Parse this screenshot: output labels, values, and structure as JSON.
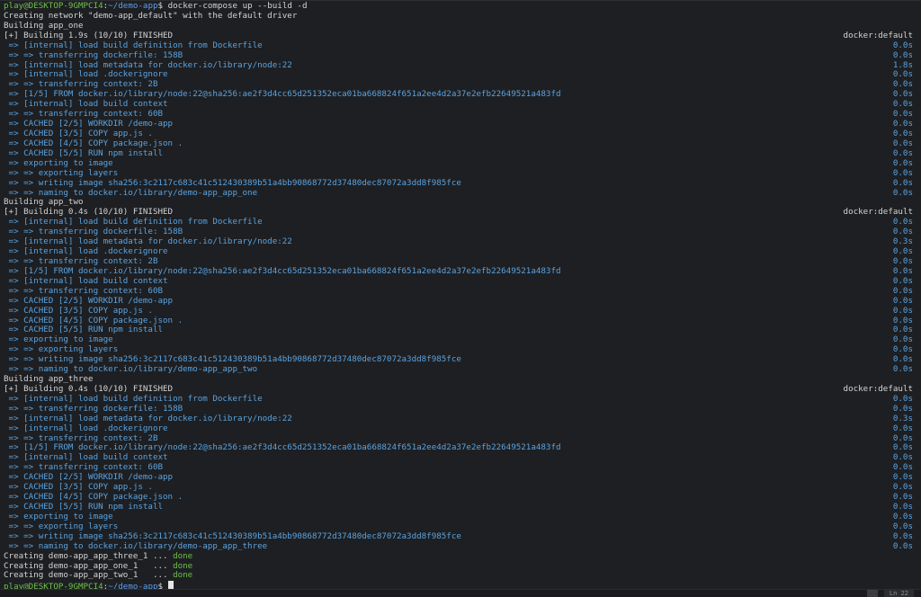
{
  "prompt": {
    "user_host": "play@DESKTOP-9GMPCI4",
    "path": "~/demo-app",
    "command": " docker-compose up --build -d"
  },
  "network_line": "Creating network \"demo-app_default\" with the default driver",
  "builds": [
    {
      "title": "Building app_one",
      "header": "[+] Building 1.9s (10/10) FINISHED",
      "driver": "docker:default",
      "steps": [
        {
          "text": " => [internal] load build definition from Dockerfile",
          "time": "0.0s"
        },
        {
          "text": " => => transferring dockerfile: 158B",
          "time": "0.0s"
        },
        {
          "text": " => [internal] load metadata for docker.io/library/node:22",
          "time": "1.8s"
        },
        {
          "text": " => [internal] load .dockerignore",
          "time": "0.0s"
        },
        {
          "text": " => => transferring context: 2B",
          "time": "0.0s"
        },
        {
          "text": " => [1/5] FROM docker.io/library/node:22@sha256:ae2f3d4cc65d251352eca01ba668824f651a2ee4d2a37e2efb22649521a483fd",
          "time": "0.0s"
        },
        {
          "text": " => [internal] load build context",
          "time": "0.0s"
        },
        {
          "text": " => => transferring context: 60B",
          "time": "0.0s"
        },
        {
          "text": " => CACHED [2/5] WORKDIR /demo-app",
          "time": "0.0s"
        },
        {
          "text": " => CACHED [3/5] COPY app.js .",
          "time": "0.0s"
        },
        {
          "text": " => CACHED [4/5] COPY package.json .",
          "time": "0.0s"
        },
        {
          "text": " => CACHED [5/5] RUN npm install",
          "time": "0.0s"
        },
        {
          "text": " => exporting to image",
          "time": "0.0s"
        },
        {
          "text": " => => exporting layers",
          "time": "0.0s"
        },
        {
          "text": " => => writing image sha256:3c2117c683c41c512430389b51a4bb90868772d37480dec87072a3dd8f985fce",
          "time": "0.0s"
        },
        {
          "text": " => => naming to docker.io/library/demo-app_app_one",
          "time": "0.0s"
        }
      ]
    },
    {
      "title": "Building app_two",
      "header": "[+] Building 0.4s (10/10) FINISHED",
      "driver": "docker:default",
      "steps": [
        {
          "text": " => [internal] load build definition from Dockerfile",
          "time": "0.0s"
        },
        {
          "text": " => => transferring dockerfile: 158B",
          "time": "0.0s"
        },
        {
          "text": " => [internal] load metadata for docker.io/library/node:22",
          "time": "0.3s"
        },
        {
          "text": " => [internal] load .dockerignore",
          "time": "0.0s"
        },
        {
          "text": " => => transferring context: 2B",
          "time": "0.0s"
        },
        {
          "text": " => [1/5] FROM docker.io/library/node:22@sha256:ae2f3d4cc65d251352eca01ba668824f651a2ee4d2a37e2efb22649521a483fd",
          "time": "0.0s"
        },
        {
          "text": " => [internal] load build context",
          "time": "0.0s"
        },
        {
          "text": " => => transferring context: 60B",
          "time": "0.0s"
        },
        {
          "text": " => CACHED [2/5] WORKDIR /demo-app",
          "time": "0.0s"
        },
        {
          "text": " => CACHED [3/5] COPY app.js .",
          "time": "0.0s"
        },
        {
          "text": " => CACHED [4/5] COPY package.json .",
          "time": "0.0s"
        },
        {
          "text": " => CACHED [5/5] RUN npm install",
          "time": "0.0s"
        },
        {
          "text": " => exporting to image",
          "time": "0.0s"
        },
        {
          "text": " => => exporting layers",
          "time": "0.0s"
        },
        {
          "text": " => => writing image sha256:3c2117c683c41c512430389b51a4bb90868772d37480dec87072a3dd8f985fce",
          "time": "0.0s"
        },
        {
          "text": " => => naming to docker.io/library/demo-app_app_two",
          "time": "0.0s"
        }
      ]
    },
    {
      "title": "Building app_three",
      "header": "[+] Building 0.4s (10/10) FINISHED",
      "driver": "docker:default",
      "steps": [
        {
          "text": " => [internal] load build definition from Dockerfile",
          "time": "0.0s"
        },
        {
          "text": " => => transferring dockerfile: 158B",
          "time": "0.0s"
        },
        {
          "text": " => [internal] load metadata for docker.io/library/node:22",
          "time": "0.3s"
        },
        {
          "text": " => [internal] load .dockerignore",
          "time": "0.0s"
        },
        {
          "text": " => => transferring context: 2B",
          "time": "0.0s"
        },
        {
          "text": " => [1/5] FROM docker.io/library/node:22@sha256:ae2f3d4cc65d251352eca01ba668824f651a2ee4d2a37e2efb22649521a483fd",
          "time": "0.0s"
        },
        {
          "text": " => [internal] load build context",
          "time": "0.0s"
        },
        {
          "text": " => => transferring context: 60B",
          "time": "0.0s"
        },
        {
          "text": " => CACHED [2/5] WORKDIR /demo-app",
          "time": "0.0s"
        },
        {
          "text": " => CACHED [3/5] COPY app.js .",
          "time": "0.0s"
        },
        {
          "text": " => CACHED [4/5] COPY package.json .",
          "time": "0.0s"
        },
        {
          "text": " => CACHED [5/5] RUN npm install",
          "time": "0.0s"
        },
        {
          "text": " => exporting to image",
          "time": "0.0s"
        },
        {
          "text": " => => exporting layers",
          "time": "0.0s"
        },
        {
          "text": " => => writing image sha256:3c2117c683c41c512430389b51a4bb90868772d37480dec87072a3dd8f985fce",
          "time": "0.0s"
        },
        {
          "text": " => => naming to docker.io/library/demo-app_app_three",
          "time": "0.0s"
        }
      ]
    }
  ],
  "creating": [
    {
      "text": "Creating demo-app_app_three_1 ... ",
      "status": "done"
    },
    {
      "text": "Creating demo-app_app_one_1   ... ",
      "status": "done"
    },
    {
      "text": "Creating demo-app_app_two_1   ... ",
      "status": "done"
    }
  ],
  "final_prompt": {
    "user_host": "play@DESKTOP-9GMPCI4",
    "path": "~/demo-app"
  },
  "statusbar": {
    "position": "Ln 22"
  },
  "colors": {
    "background": "#1e1f22",
    "text": "#d4d4d4",
    "step_blue": "#5aa3e0",
    "done_green": "#6cc04a",
    "prompt_green": "#6cc04a",
    "path_blue": "#5a9ee8"
  }
}
